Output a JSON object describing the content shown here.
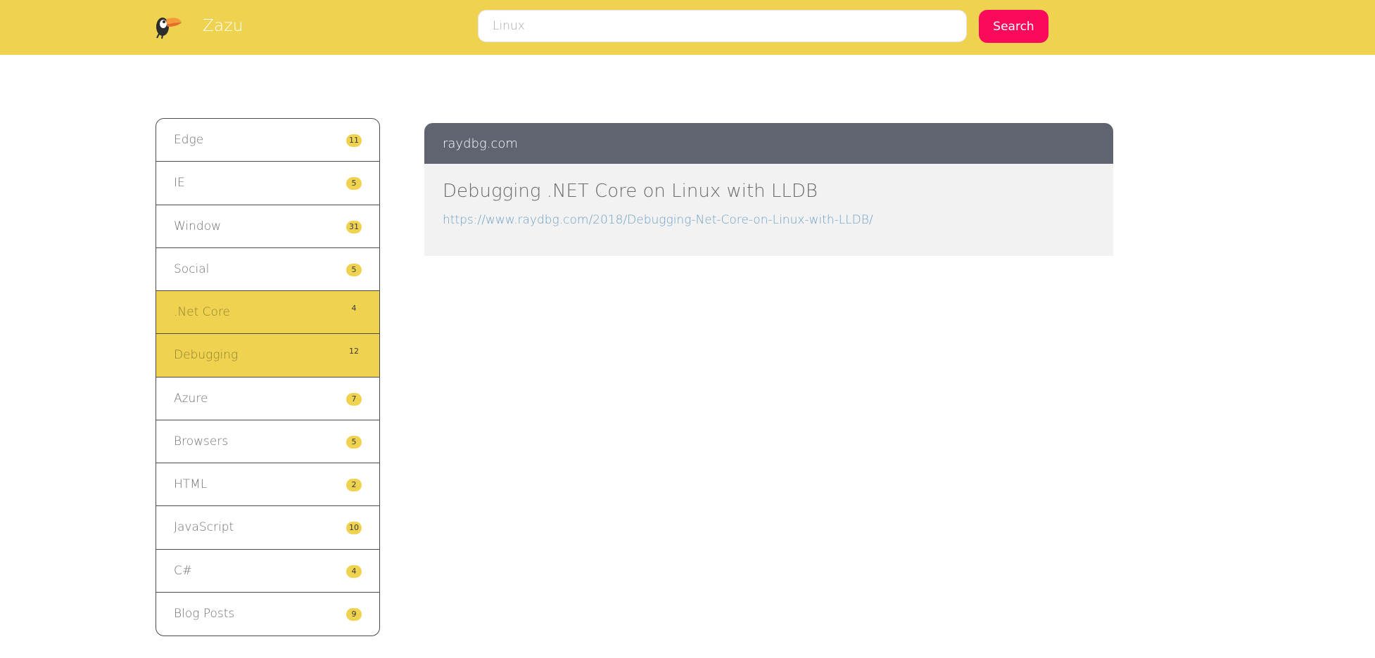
{
  "header": {
    "logo_icon": "toucan-icon",
    "brand": "Zazu",
    "search": {
      "value": "Linux",
      "placeholder": ""
    },
    "search_button_label": "Search",
    "colors": {
      "header_bg": "#efd350",
      "search_button_bg": "#fb0a5b"
    }
  },
  "sidebar": {
    "items": [
      {
        "label": "Edge",
        "count": "11",
        "active": false
      },
      {
        "label": "IE",
        "count": "5",
        "active": false
      },
      {
        "label": "Window",
        "count": "31",
        "active": false
      },
      {
        "label": "Social",
        "count": "5",
        "active": false
      },
      {
        "label": ".Net Core",
        "count": "4",
        "active": true
      },
      {
        "label": "Debugging",
        "count": "12",
        "active": true
      },
      {
        "label": "Azure",
        "count": "7",
        "active": false
      },
      {
        "label": "Browsers",
        "count": "5",
        "active": false
      },
      {
        "label": "HTML",
        "count": "2",
        "active": false
      },
      {
        "label": "JavaScript",
        "count": "10",
        "active": false
      },
      {
        "label": "C#",
        "count": "4",
        "active": false
      },
      {
        "label": "Blog Posts",
        "count": "9",
        "active": false
      }
    ]
  },
  "results": [
    {
      "site": "raydbg.com",
      "title": "Debugging .NET Core on Linux with LLDB",
      "url": "https://www.raydbg.com/2018/Debugging-Net-Core-on-Linux-with-LLDB/"
    }
  ]
}
